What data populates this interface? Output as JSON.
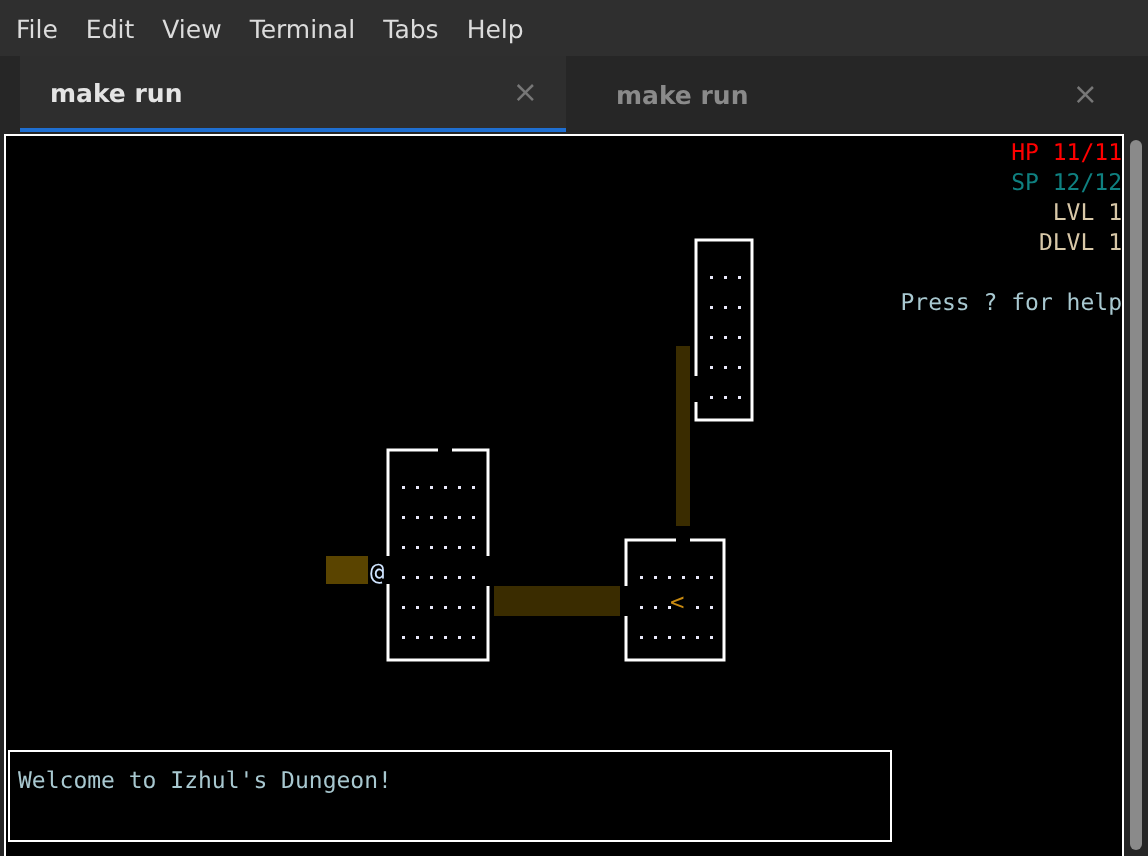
{
  "menu": [
    "File",
    "Edit",
    "View",
    "Terminal",
    "Tabs",
    "Help"
  ],
  "tabs": [
    {
      "label": "make run",
      "selected": true,
      "close": "×"
    },
    {
      "label": "make run",
      "selected": false,
      "close": "×"
    }
  ],
  "terminal": {
    "stats": [
      {
        "text": "HP 11/11",
        "color": "#ff0000"
      },
      {
        "text": "SP 12/12",
        "color": "#0f8080"
      },
      {
        "text": "LVL 1",
        "color": "#d8c8a8"
      },
      {
        "text": "DLVL 1",
        "color": "#d8c8a8"
      }
    ],
    "help": "Press ? for help",
    "map": {
      "player": "@",
      "stairs": "<"
    },
    "message": "Welcome to Izhul's Dungeon!"
  }
}
